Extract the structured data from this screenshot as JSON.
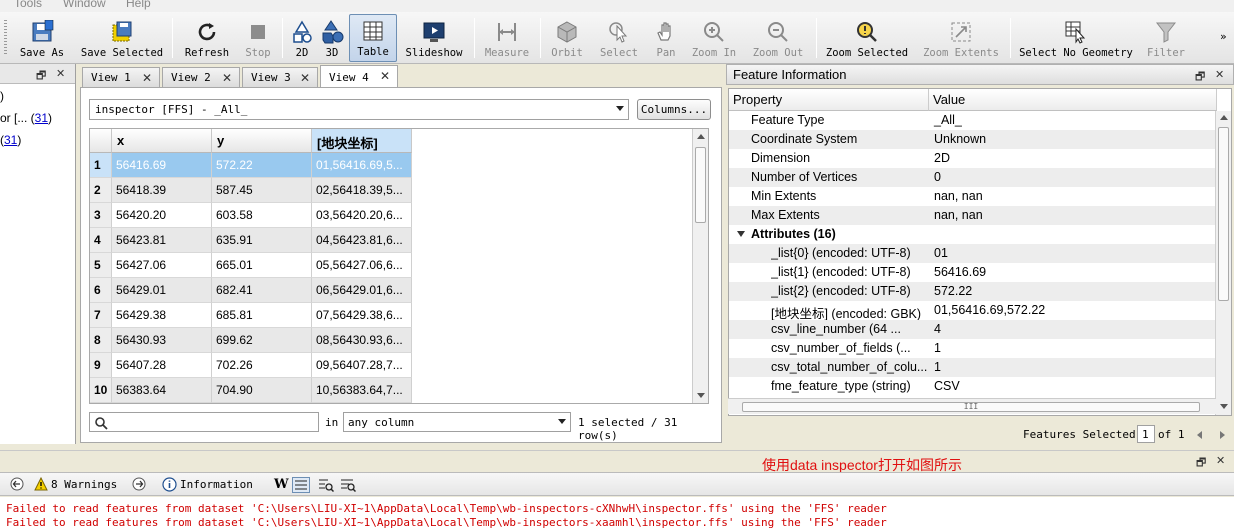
{
  "menubar": {
    "items": [
      "Tools",
      "Window",
      "Help"
    ]
  },
  "toolbar": {
    "buttons": [
      {
        "label": "Save As",
        "icon": "save-as-icon",
        "enabled": true
      },
      {
        "label": "Save Selected",
        "icon": "save-selected-icon",
        "enabled": true
      },
      {
        "label": "Refresh",
        "icon": "refresh-icon",
        "enabled": true
      },
      {
        "label": "Stop",
        "icon": "stop-icon",
        "enabled": false
      },
      {
        "label": "2D",
        "icon": "2d-shapes-icon",
        "enabled": true
      },
      {
        "label": "3D",
        "icon": "3d-shapes-icon",
        "enabled": true
      },
      {
        "label": "Table",
        "icon": "table-icon",
        "enabled": true,
        "active": true
      },
      {
        "label": "Slideshow",
        "icon": "slideshow-icon",
        "enabled": true
      },
      {
        "label": "Measure",
        "icon": "measure-icon",
        "enabled": false
      },
      {
        "label": "Orbit",
        "icon": "orbit-icon",
        "enabled": false
      },
      {
        "label": "Select",
        "icon": "select-cursor-icon",
        "enabled": false
      },
      {
        "label": "Pan",
        "icon": "pan-hand-icon",
        "enabled": false
      },
      {
        "label": "Zoom In",
        "icon": "zoom-in-icon",
        "enabled": false
      },
      {
        "label": "Zoom Out",
        "icon": "zoom-out-icon",
        "enabled": false
      },
      {
        "label": "Zoom Selected",
        "icon": "zoom-selected-icon",
        "enabled": true
      },
      {
        "label": "Zoom Extents",
        "icon": "zoom-extents-icon",
        "enabled": false
      },
      {
        "label": "Select No Geometry",
        "icon": "select-no-geometry-icon",
        "enabled": true
      },
      {
        "label": "Filter",
        "icon": "filter-icon",
        "enabled": false
      }
    ],
    "overflow": "»"
  },
  "left_panel": {
    "lines": [
      {
        "text": ")",
        "link": ""
      },
      {
        "text": "or [... (",
        "link": "31",
        "tail": ")"
      },
      {
        "text": "(",
        "link": "31",
        "tail": ")"
      }
    ]
  },
  "views": {
    "tabs": [
      "View 1",
      "View 2",
      "View 3",
      "View 4"
    ],
    "selected": "View 4",
    "dataset_combo": "inspector [FFS] - _All_",
    "columns_button": "Columns...",
    "table": {
      "headers": [
        "x",
        "y",
        "[地块坐标]"
      ],
      "rows": [
        {
          "n": "1",
          "x": "56416.69",
          "y": "572.22",
          "z": "01,56416.69,5..."
        },
        {
          "n": "2",
          "x": "56418.39",
          "y": "587.45",
          "z": "02,56418.39,5..."
        },
        {
          "n": "3",
          "x": "56420.20",
          "y": "603.58",
          "z": "03,56420.20,6..."
        },
        {
          "n": "4",
          "x": "56423.81",
          "y": "635.91",
          "z": "04,56423.81,6..."
        },
        {
          "n": "5",
          "x": "56427.06",
          "y": "665.01",
          "z": "05,56427.06,6..."
        },
        {
          "n": "6",
          "x": "56429.01",
          "y": "682.41",
          "z": "06,56429.01,6..."
        },
        {
          "n": "7",
          "x": "56429.38",
          "y": "685.81",
          "z": "07,56429.38,6..."
        },
        {
          "n": "8",
          "x": "56430.93",
          "y": "699.62",
          "z": "08,56430.93,6..."
        },
        {
          "n": "9",
          "x": "56407.28",
          "y": "702.26",
          "z": "09,56407.28,7..."
        },
        {
          "n": "10",
          "x": "56383.64",
          "y": "704.90",
          "z": "10,56383.64,7..."
        }
      ]
    },
    "search_placeholder": "",
    "in_label": "in",
    "column_combo": "any column",
    "selection_status": "1 selected / 31 row(s)"
  },
  "feature_info": {
    "title": "Feature Information",
    "headers": [
      "Property",
      "Value"
    ],
    "rows": [
      {
        "prop": "Feature Type",
        "value": "_All_",
        "indent": 1,
        "bold": false
      },
      {
        "prop": "Coordinate System",
        "value": "Unknown",
        "indent": 1,
        "bold": false
      },
      {
        "prop": "Dimension",
        "value": "2D",
        "indent": 1,
        "bold": false
      },
      {
        "prop": "Number of Vertices",
        "value": "0",
        "indent": 1,
        "bold": false
      },
      {
        "prop": "Min Extents",
        "value": "nan, nan",
        "indent": 1,
        "bold": false
      },
      {
        "prop": "Max Extents",
        "value": "nan, nan",
        "indent": 1,
        "bold": false
      },
      {
        "prop": "Attributes (16)",
        "value": "",
        "indent": 0,
        "bold": true
      },
      {
        "prop": "_list{0} (encoded: UTF-8)",
        "value": "01",
        "indent": 2,
        "bold": false
      },
      {
        "prop": "_list{1} (encoded: UTF-8)",
        "value": "56416.69",
        "indent": 2,
        "bold": false
      },
      {
        "prop": "_list{2} (encoded: UTF-8)",
        "value": "572.22",
        "indent": 2,
        "bold": false
      },
      {
        "prop": "[地块坐标] (encoded: GBK)",
        "value": "01,56416.69,572.22",
        "indent": 2,
        "bold": false
      },
      {
        "prop": "csv_line_number (64 ...",
        "value": "4",
        "indent": 2,
        "bold": false
      },
      {
        "prop": "csv_number_of_fields (...",
        "value": "1",
        "indent": 2,
        "bold": false
      },
      {
        "prop": "csv_total_number_of_colu...",
        "value": "1",
        "indent": 2,
        "bold": false
      },
      {
        "prop": "fme_feature_type (string)",
        "value": "CSV",
        "indent": 2,
        "bold": false
      }
    ],
    "features_selected_label": "Features Selected:",
    "features_selected_value": "1",
    "of_label": "of 1"
  },
  "log": {
    "toolbar": {
      "warnings": "8 Warnings",
      "information": "Information"
    },
    "lines": [
      "Failed to read features from dataset 'C:\\Users\\LIU-XI~1\\AppData\\Local\\Temp\\wb-inspectors-cXNhwH\\inspector.ffs' using the 'FFS' reader",
      "Failed to read features from dataset 'C:\\Users\\LIU-XI~1\\AppData\\Local\\Temp\\wb-inspectors-xaamhl\\inspector.ffs' using the 'FFS' reader"
    ]
  },
  "annotation": "使用data inspector打开如图所示",
  "colors": {
    "selection": "#99c9ef",
    "header_highlight": "#c9e2f8",
    "log_error": "#d00000",
    "annotation": "#e01010",
    "link": "#0000cc"
  }
}
